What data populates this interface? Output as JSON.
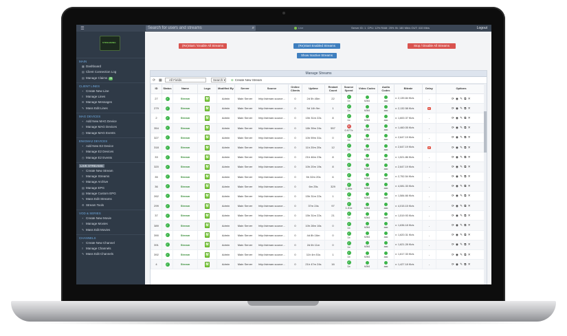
{
  "topbar": {
    "search_placeholder": "Search for users and streams",
    "status": "Live",
    "server": "Server ID: 1",
    "sys_stats": "CPU: 12%  RAM: 25%  IN: 180 Mb/s  OUT: 410 Mb/s",
    "logout": "Logout"
  },
  "logo": {
    "text": "STREAMING"
  },
  "sidebar": {
    "main": "MAIN",
    "dashboard": "Dashboard",
    "client_log": "Client Connection Log",
    "manage_claims": "Manage Claims",
    "claims_count": "28",
    "client_lines": "CLIENT LINES",
    "create_line": "Create New Line",
    "manage_lines": "Manage Lines",
    "manage_messages": "Manage Messages",
    "mass_edit_lines": "Mass Edit Lines",
    "mag_devices": "MAG DEVICES",
    "add_mag": "Add New MAG Device",
    "manage_mag": "Manage MAG Devices",
    "manage_mag_events": "Manage MAG Events",
    "enigma_devices": "ENIGMA2 DEVICES",
    "add_e2": "Add New E2 Device",
    "manage_e2": "Manage E2 Devices",
    "manage_e2_events": "Manage E2 Events",
    "live_streams": "LIVE STREAMS",
    "create_stream": "Create New Stream",
    "manage_streams": "Manage Streams",
    "manage_archive": "Manage Archive",
    "manage_epg": "Manage EPG",
    "manage_custom_epg": "Manage Custom EPG",
    "mass_edit_streams": "Mass Edit Streams",
    "stream_tools": "Stream Tools",
    "vod_series": "VOD & SERIES",
    "create_movie": "Create New Movie",
    "manage_movies": "Manage Movies",
    "mass_edit_movies": "Mass Edit Movies",
    "channels": "CHANNELS",
    "create_channel": "Create New Channel",
    "manage_channels": "Manage Channels",
    "mass_edit_channels": "Mass Edit Channels"
  },
  "actions": {
    "restart_all": "(Re)Start / Enable All Streams",
    "restart_enabled": "(Re)Start Enabled Streams",
    "show_inactive": "Show Inactive Streams",
    "stop_all": "Stop / Disable All Streams"
  },
  "panel": {
    "title": "Manage Streams",
    "filter": "All Fields",
    "search": "Search",
    "create": "Create New Stream"
  },
  "table": {
    "headers": [
      "ID",
      "Status",
      "Name",
      "Logo",
      "Modified By",
      "Server",
      "Source",
      "Online Clients",
      "Uptime",
      "Restart Count",
      "Source Speed",
      "Video Codec",
      "Audio Codec",
      "Bitrate",
      "Delay",
      "Options"
    ],
    "rows": [
      {
        "id": "27",
        "uptime": "2d 5h 45m",
        "restart": "22",
        "speed": "1x",
        "bitrate": "v: 2,139.84 Kb/s",
        "delay": ""
      },
      {
        "id": "279",
        "uptime": "5d 14h 9m",
        "restart": "1",
        "speed": "1x",
        "bitrate": "v: 2,132.58 Kb/s",
        "delay": "1h"
      },
      {
        "id": "2",
        "uptime": "15h 31m 22s",
        "restart": "8",
        "speed": "1x",
        "bitrate": "v: 1,600.37 Kb/s",
        "delay": ""
      },
      {
        "id": "354",
        "uptime": "18h 39m 24s",
        "restart": "557",
        "speed": "0.977x",
        "bitrate": "v: 1,460.05 Kb/s",
        "delay": ""
      },
      {
        "id": "327",
        "uptime": "10h 59m 31s",
        "restart": "0",
        "speed": "1x",
        "bitrate": "v: 2,647.19 Kb/s",
        "delay": ""
      },
      {
        "id": "318",
        "uptime": "11h 20m 20s",
        "restart": "12",
        "speed": "1x",
        "bitrate": "v: 2,647.19 Kb/s",
        "delay": "2h"
      },
      {
        "id": "33",
        "uptime": "21h 46m 23s",
        "restart": "8",
        "speed": "1x",
        "bitrate": "v: 1,521.86 Kb/s",
        "delay": ""
      },
      {
        "id": "320",
        "uptime": "10h 20m 19s",
        "restart": "8",
        "speed": "1x",
        "bitrate": "v: 2,647.19 Kb/s",
        "delay": ""
      },
      {
        "id": "35",
        "uptime": "5h 32m 20s",
        "restart": "6",
        "speed": "1x",
        "bitrate": "v: 2,752.54 Kb/s",
        "delay": ""
      },
      {
        "id": "36",
        "uptime": "6m 25s",
        "restart": "329",
        "speed": "1.09x",
        "bitrate": "v: 4,081.33 Kb/s",
        "delay": ""
      },
      {
        "id": "262",
        "uptime": "15h 31m 22s",
        "restart": "1",
        "speed": "1x",
        "bitrate": "v: 1,584.66 Kb/s",
        "delay": ""
      },
      {
        "id": "299",
        "uptime": "37m 24s",
        "restart": "97",
        "speed": "1.01x",
        "bitrate": "v: 4,015.15 Kb/s",
        "delay": ""
      },
      {
        "id": "37",
        "uptime": "15h 31m 22s",
        "restart": "21",
        "speed": "1x",
        "bitrate": "v: 1,519.93 Kb/s",
        "delay": ""
      },
      {
        "id": "389",
        "uptime": "10h 28m 16s",
        "restart": "0",
        "speed": "1x",
        "bitrate": "v: 1,636.18 Kb/s",
        "delay": ""
      },
      {
        "id": "390",
        "uptime": "4d 8h 16m",
        "restart": "0",
        "speed": "1x",
        "bitrate": "v: 1,620.31 Kb/s",
        "delay": ""
      },
      {
        "id": "391",
        "uptime": "2d 6h 11m",
        "restart": "0",
        "speed": "1x",
        "bitrate": "v: 1,621.28 Kb/s",
        "delay": ""
      },
      {
        "id": "392",
        "uptime": "11h 4m 51s",
        "restart": "1",
        "speed": "1x",
        "bitrate": "v: 1,617.33 Kb/s",
        "delay": ""
      },
      {
        "id": "4",
        "uptime": "21h 47m 24s",
        "restart": "16",
        "speed": "1x",
        "bitrate": "v: 1,427.18 Kb/s",
        "delay": ""
      }
    ],
    "name": "Stream",
    "logo_letter": "M",
    "modified_by": "Admin",
    "server": "Main Server",
    "source": "http://stream.source...",
    "online": "0",
    "video_codec": "h264",
    "audio_codec": "aac",
    "options": "⟳ ◉ ✎ ⧉ ✕"
  }
}
